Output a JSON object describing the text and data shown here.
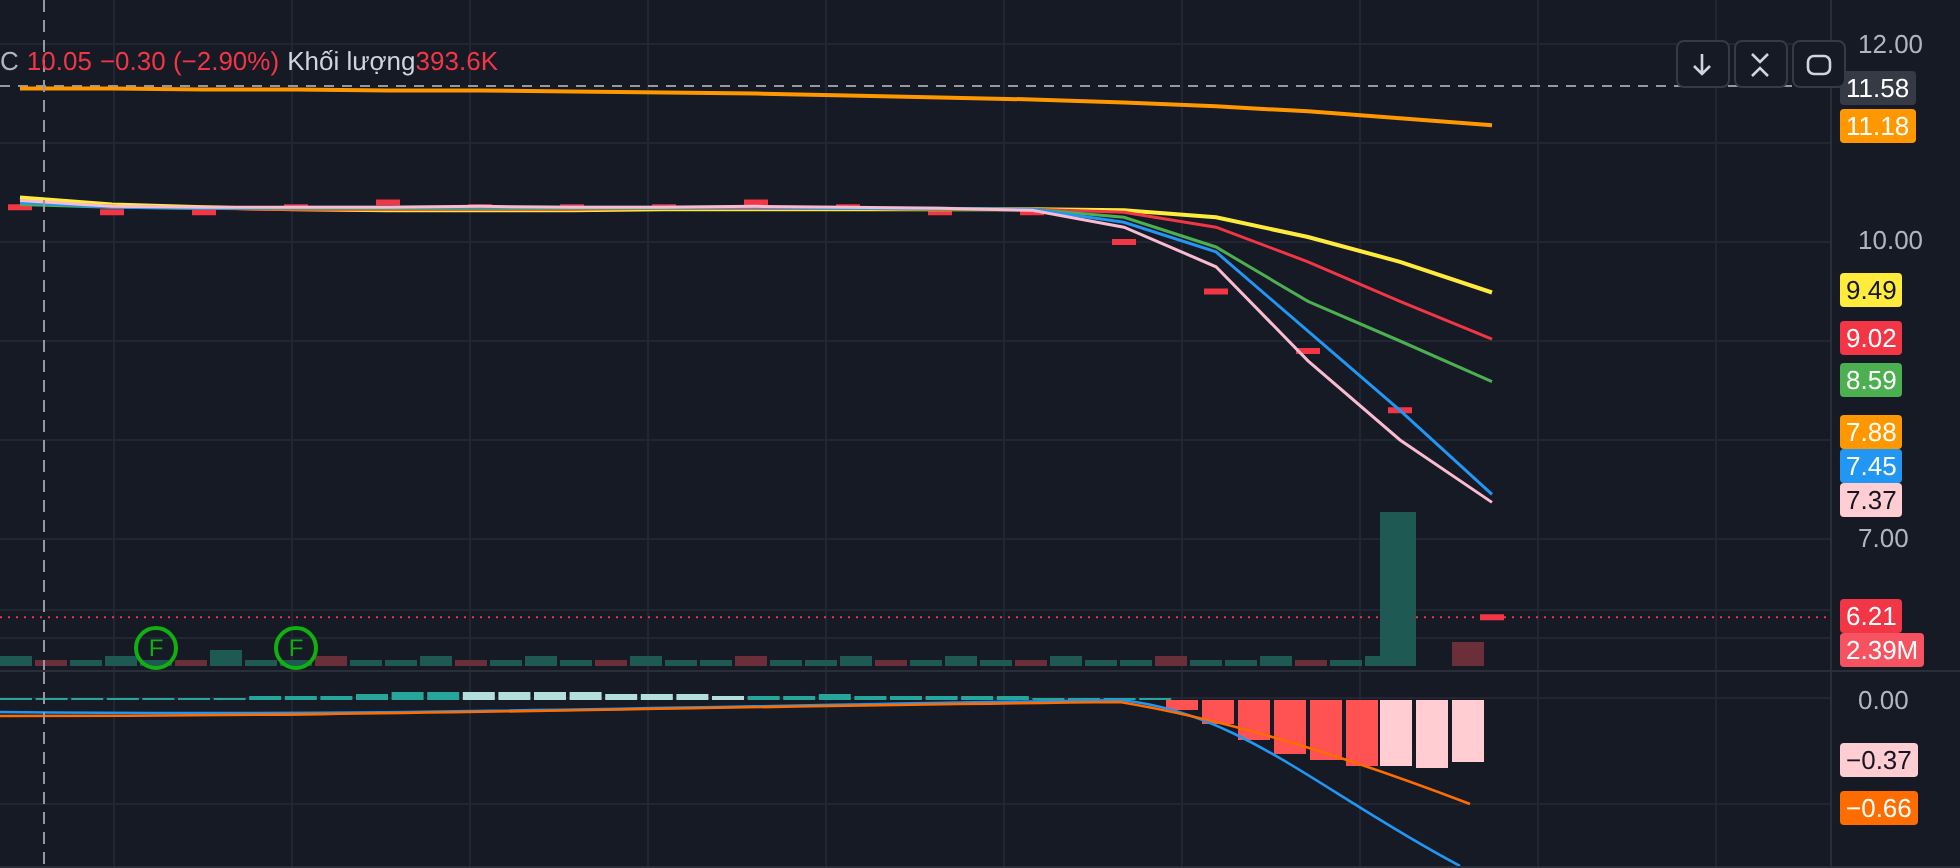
{
  "legend": {
    "series_label": "C",
    "value": "10.05",
    "change": "−0.30 (−2.90%)",
    "volume_label": "Khối lượng",
    "volume_value": "393.6K"
  },
  "toolbar": {
    "buttons": [
      {
        "kind": "down"
      },
      {
        "kind": "collapse"
      },
      {
        "kind": "fullscreen"
      }
    ]
  },
  "price_pane": {
    "axis_ticks": [
      "12.00",
      "10.00",
      "7.00"
    ],
    "markers": [
      {
        "label": "F"
      },
      {
        "label": "F"
      }
    ],
    "axis_tags": [
      {
        "text": "11.58",
        "color": "#363a45"
      },
      {
        "text": "11.18",
        "color": "#ff9800"
      },
      {
        "text": "9.49",
        "color": "#ffeb3b"
      },
      {
        "text": "9.02",
        "color": "#f23645"
      },
      {
        "text": "8.59",
        "color": "#4caf50"
      },
      {
        "text": "7.88",
        "color": "#ff9800"
      },
      {
        "text": "7.45",
        "color": "#2196f3"
      },
      {
        "text": "7.37",
        "color": "#ffcdd2"
      },
      {
        "text": "6.21",
        "color": "#f23645"
      },
      {
        "text": "2.39M",
        "color": "#f7525f"
      }
    ]
  },
  "macd_pane": {
    "axis_tick": "0.00",
    "axis_tags": [
      {
        "text": "−0.37",
        "color": "#ffcdd2"
      },
      {
        "text": "−0.66",
        "color": "#ff6d00"
      }
    ]
  }
}
